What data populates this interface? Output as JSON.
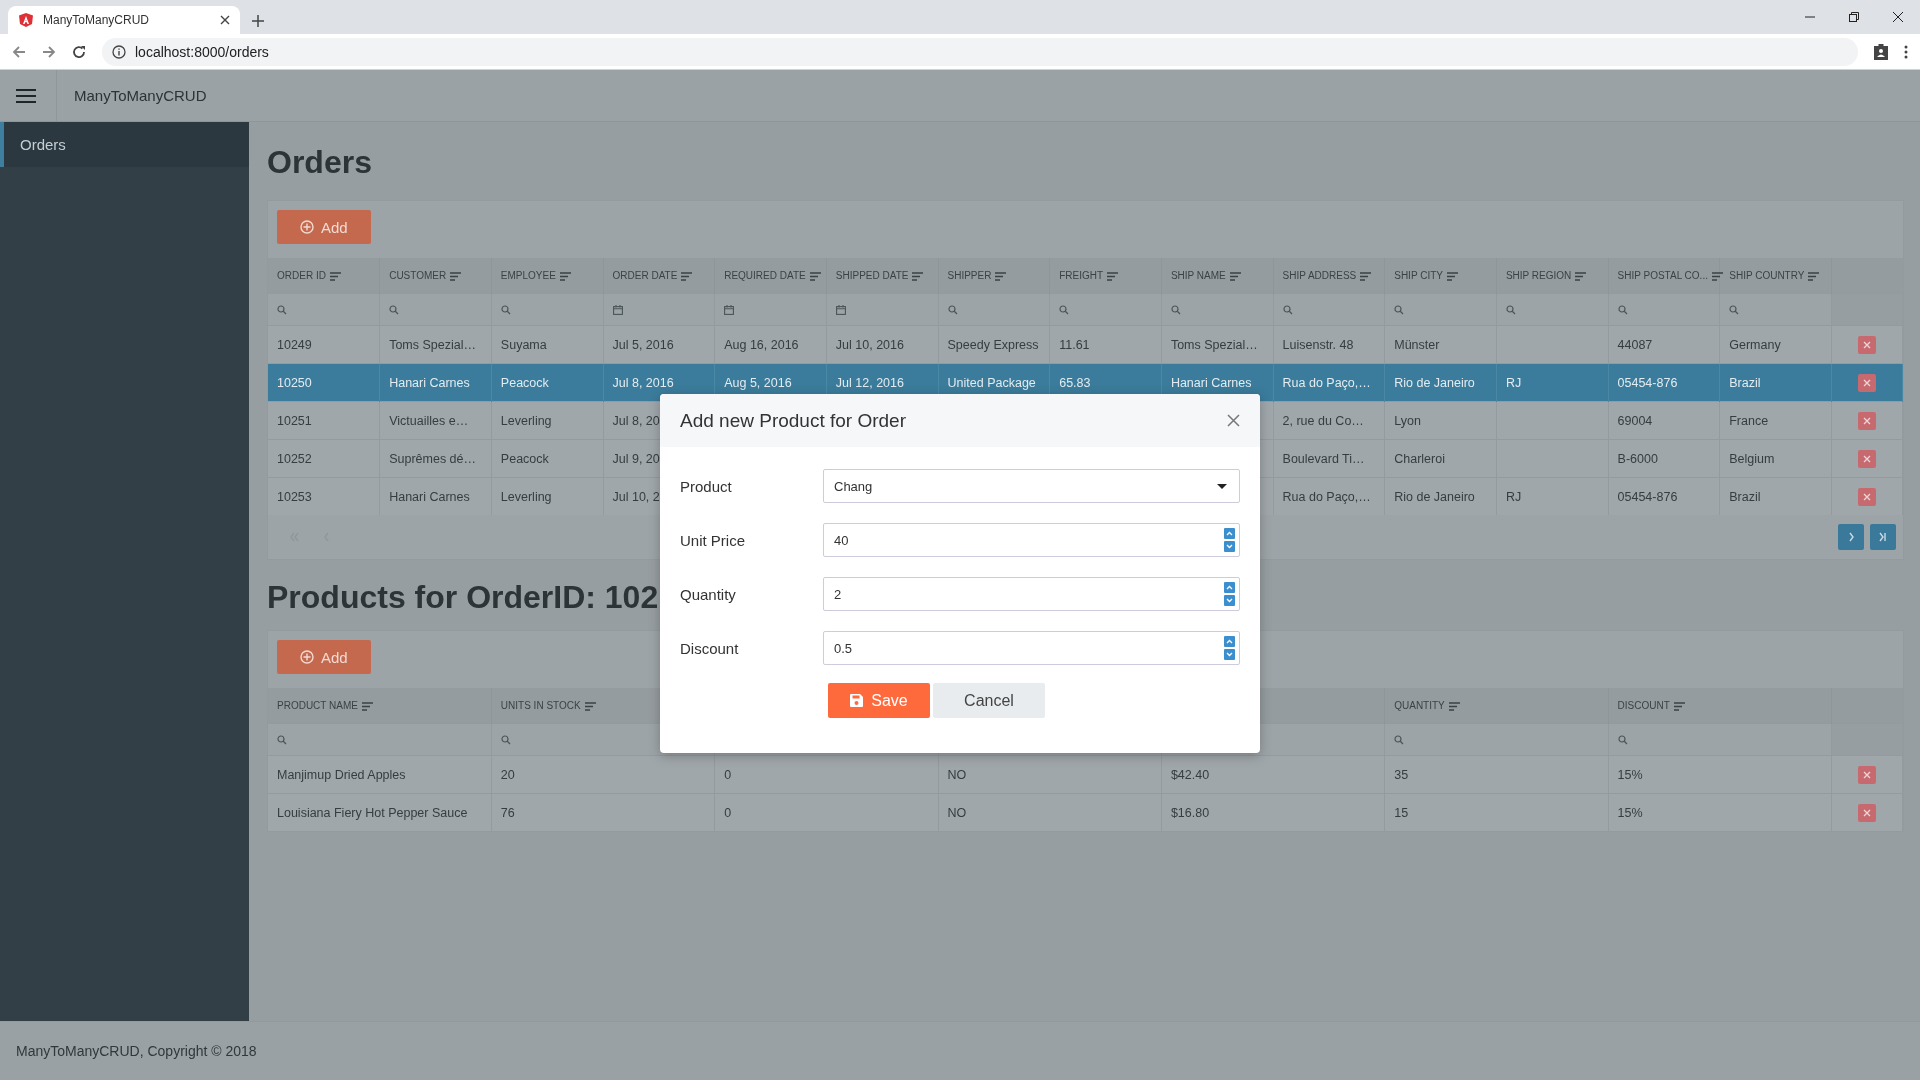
{
  "browser": {
    "tab_title": "ManyToManyCRUD",
    "url": "localhost:8000/orders"
  },
  "app": {
    "title": "ManyToManyCRUD"
  },
  "sidebar": {
    "items": [
      {
        "label": "Orders",
        "selected": true
      }
    ]
  },
  "orders": {
    "title": "Orders",
    "add_button": "Add",
    "columns": [
      {
        "label": "ORDER ID",
        "kind": "text"
      },
      {
        "label": "CUSTOMER",
        "kind": "text"
      },
      {
        "label": "EMPLOYEE",
        "kind": "text"
      },
      {
        "label": "ORDER DATE",
        "kind": "date"
      },
      {
        "label": "REQUIRED DATE",
        "kind": "date"
      },
      {
        "label": "SHIPPED DATE",
        "kind": "date"
      },
      {
        "label": "SHIPPER",
        "kind": "text"
      },
      {
        "label": "FREIGHT",
        "kind": "text"
      },
      {
        "label": "SHIP NAME",
        "kind": "text"
      },
      {
        "label": "SHIP ADDRESS",
        "kind": "text"
      },
      {
        "label": "SHIP CITY",
        "kind": "text"
      },
      {
        "label": "SHIP REGION",
        "kind": "text"
      },
      {
        "label": "SHIP POSTAL CO...",
        "kind": "text"
      },
      {
        "label": "SHIP COUNTRY",
        "kind": "text"
      }
    ],
    "rows": [
      {
        "selected": false,
        "cells": [
          "10249",
          "Toms Spezial…",
          "Suyama",
          "Jul 5, 2016",
          "Aug 16, 2016",
          "Jul 10, 2016",
          "Speedy Express",
          "11.61",
          "Toms Spezial…",
          "Luisenstr. 48",
          "Münster",
          null,
          "44087",
          "Germany"
        ]
      },
      {
        "selected": true,
        "cells": [
          "10250",
          "Hanari Carnes",
          "Peacock",
          "Jul 8, 2016",
          "Aug 5, 2016",
          "Jul 12, 2016",
          "United Package",
          "65.83",
          "Hanari Carnes",
          "Rua do Paço,…",
          "Rio de Janeiro",
          "RJ",
          "05454-876",
          "Brazil"
        ]
      },
      {
        "selected": false,
        "cells": [
          "10251",
          "Victuailles e…",
          "Leverling",
          "Jul 8, 20",
          null,
          null,
          null,
          null,
          null,
          "2, rue du Co…",
          "Lyon",
          null,
          "69004",
          "France"
        ]
      },
      {
        "selected": false,
        "cells": [
          "10252",
          "Suprêmes dé…",
          "Peacock",
          "Jul 9, 20",
          null,
          null,
          null,
          null,
          null,
          "Boulevard Ti…",
          "Charleroi",
          null,
          "B-6000",
          "Belgium"
        ]
      },
      {
        "selected": false,
        "cells": [
          "10253",
          "Hanari Carnes",
          "Leverling",
          "Jul 10, 2",
          null,
          null,
          null,
          null,
          null,
          "Rua do Paço,…",
          "Rio de Janeiro",
          "RJ",
          "05454-876",
          "Brazil"
        ]
      }
    ],
    "pagination": [
      {
        "kind": "first",
        "disabled": true
      },
      {
        "kind": "prev",
        "disabled": true
      },
      {
        "kind": "next",
        "disabled": false
      },
      {
        "kind": "last",
        "disabled": false
      }
    ]
  },
  "products": {
    "title": "Products for OrderID: 102",
    "add_button": "Add",
    "columns": [
      {
        "label": "PRODUCT NAME",
        "kind": "text"
      },
      {
        "label": "UNITS IN STOCK",
        "kind": "text"
      },
      {},
      {},
      {},
      {
        "label": "QUANTITY",
        "kind": "text"
      },
      {
        "label": "DISCOUNT",
        "kind": "text"
      }
    ],
    "rows": [
      {
        "selected": false,
        "cells": [
          "Manjimup Dried Apples",
          "20",
          "0",
          "NO",
          "$42.40",
          "35",
          "15%"
        ]
      },
      {
        "selected": false,
        "cells": [
          "Louisiana Fiery Hot Pepper Sauce",
          "76",
          "0",
          "NO",
          "$16.80",
          "15",
          "15%"
        ]
      }
    ]
  },
  "dialog": {
    "title": "Add new Product for Order",
    "fields": [
      {
        "label": "Product",
        "kind": "select",
        "value": "Chang"
      },
      {
        "label": "Unit Price",
        "kind": "number",
        "value": "40"
      },
      {
        "label": "Quantity",
        "kind": "number",
        "value": "2"
      },
      {
        "label": "Discount",
        "kind": "number",
        "value": "0.5"
      }
    ],
    "buttons": [
      {
        "label": "Save",
        "kind": "primary"
      },
      {
        "label": "Cancel",
        "kind": "secondary"
      }
    ]
  },
  "footer": {
    "text": "ManyToManyCRUD, Copyright © 2018"
  }
}
